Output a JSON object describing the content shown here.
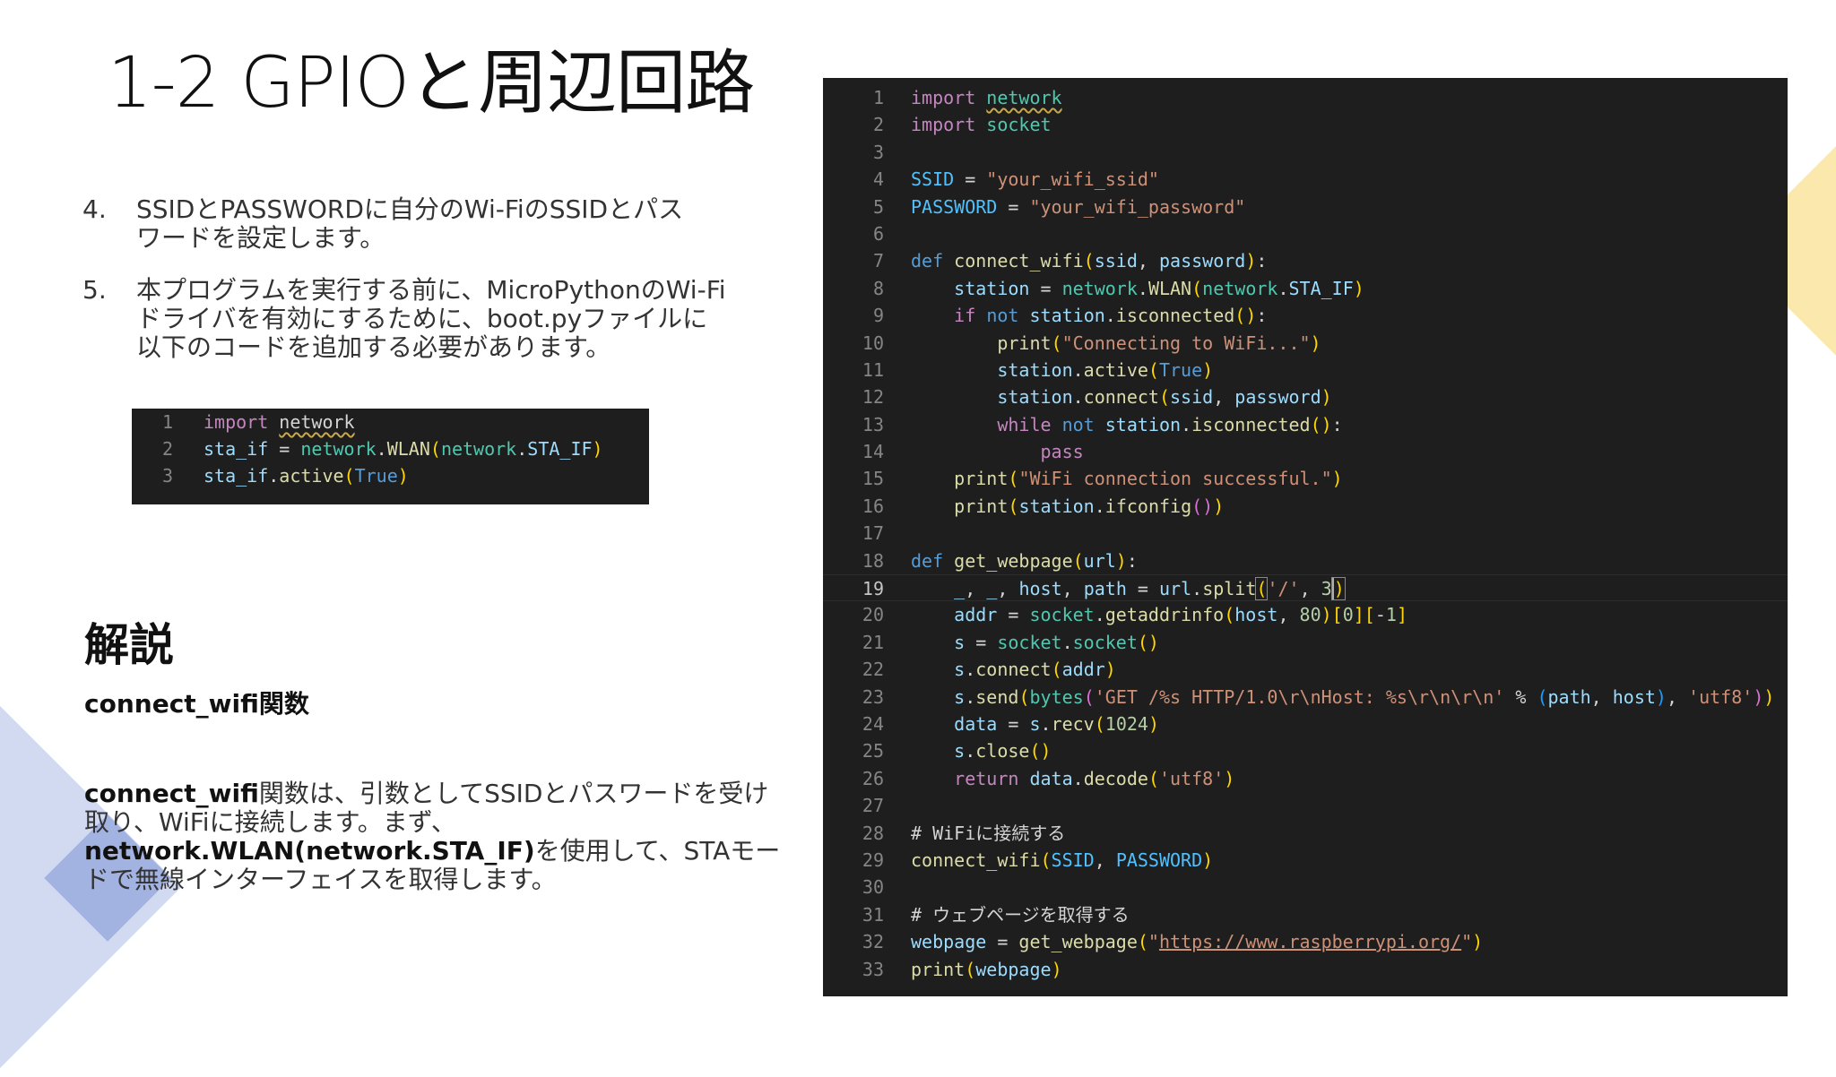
{
  "slide": {
    "title": "1-2 GPIOと周辺回路",
    "steps": [
      {
        "num": "4.",
        "text": "SSIDとPASSWORDに自分のWi-FiのSSIDとパス\nワードを設定します。"
      },
      {
        "num": "5.",
        "text": "本プログラムを実行する前に、MicroPythonのWi-Fi\nドライバを有効にするために、boot.pyファイルに\n以下のコードを追加する必要があります。"
      }
    ],
    "heading": "解説",
    "subheading": "connect_wifi関数",
    "body": {
      "b1": "connect_wifi",
      "t1": "関数は、引数としてSSIDとパスワードを受け取り、WiFiに接続します。まず、",
      "b2": "network.WLAN(network.STA_IF)",
      "t2": "を使用して、STAモードで無線インターフェイスを取得します。"
    }
  },
  "mini_code": {
    "line_numbers": [
      "1",
      "2",
      "3"
    ]
  },
  "editor": {
    "line_numbers": [
      "1",
      "2",
      "3",
      "4",
      "5",
      "6",
      "7",
      "8",
      "9",
      "10",
      "11",
      "12",
      "13",
      "14",
      "15",
      "16",
      "17",
      "18",
      "19",
      "20",
      "21",
      "22",
      "23",
      "24",
      "25",
      "26",
      "27",
      "28",
      "29",
      "30",
      "31",
      "32",
      "33"
    ],
    "active_line": "19",
    "comment_wifi": "# WiFiに接続する",
    "comment_webpage": "# ウェブページを取得する",
    "url": "https://www.raspberrypi.org/"
  },
  "colors": {
    "editor_bg": "#1e1e1e",
    "keyword": "#569cd6",
    "control": "#c586c0",
    "function": "#dcdcaa",
    "variable": "#9cdcfe",
    "string": "#ce9178",
    "comment": "#6a9955",
    "deco_blue": "#c9d3ef",
    "deco_yellow": "#fbe8ad"
  }
}
